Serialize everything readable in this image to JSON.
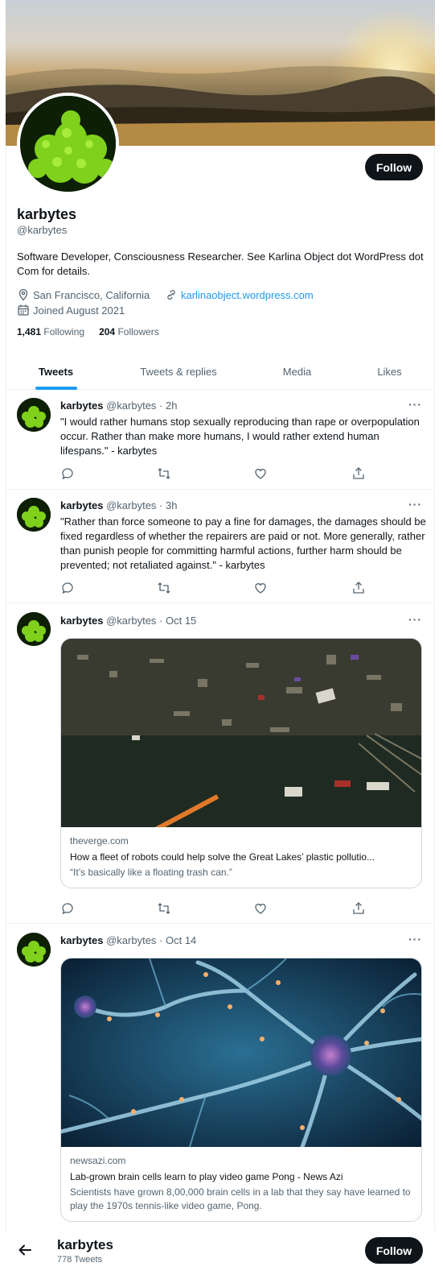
{
  "profile": {
    "name": "karbytes",
    "handle": "@karbytes",
    "bio": "Software Developer, Consciousness Researcher. See Karlina Object dot WordPress dot Com for details.",
    "location": "San Francisco, California",
    "website": "karlinaobject.wordpress.com",
    "joined": "Joined August 2021",
    "following_count": "1,481",
    "following_label": "Following",
    "followers_count": "204",
    "followers_label": "Followers",
    "follow_label": "Follow"
  },
  "tabs": [
    {
      "label": "Tweets",
      "active": true
    },
    {
      "label": "Tweets & replies",
      "active": false
    },
    {
      "label": "Media",
      "active": false
    },
    {
      "label": "Likes",
      "active": false
    }
  ],
  "tweets": [
    {
      "author": "karbytes",
      "meta": "@karbytes · 2h",
      "text": "\"I would rather humans stop sexually reproducing than rape or overpopulation occur. Rather than make more humans, I would rather extend human lifespans.\" - karbytes"
    },
    {
      "author": "karbytes",
      "meta": "@karbytes · 3h",
      "text": "\"Rather than force someone to pay a fine for damages, the damages should be fixed regardless of whether the repairers are paid or not. More generally, rather than punish people for committing harmful actions, further harm should be prevented; not retaliated against.\" - karbytes"
    },
    {
      "author": "karbytes",
      "meta": "@karbytes · Oct 15",
      "card": {
        "domain": "theverge.com",
        "title": "How a fleet of robots could help solve the Great Lakes’ plastic pollutio...",
        "description": "“It’s basically like a floating trash can.”"
      }
    },
    {
      "author": "karbytes",
      "meta": "@karbytes · Oct 14",
      "card": {
        "domain": "newsazi.com",
        "title": "Lab-grown brain cells learn to play video game Pong - News Azi",
        "description": "Scientists have grown 8,00,000 brain cells in a lab that they say have learned to play the 1970s tennis-like video game, Pong."
      }
    }
  ],
  "bottom_bar": {
    "name": "karbytes",
    "tweet_count": "778 Tweets",
    "follow_label": "Follow"
  },
  "colors": {
    "accent": "#1d9bf0",
    "text": "#0f1419",
    "muted": "#536471",
    "button": "#0f1419"
  },
  "icons": [
    "location-icon",
    "link-icon",
    "calendar-icon",
    "reply-icon",
    "retweet-icon",
    "like-icon",
    "share-icon",
    "more-icon",
    "back-arrow-icon"
  ]
}
